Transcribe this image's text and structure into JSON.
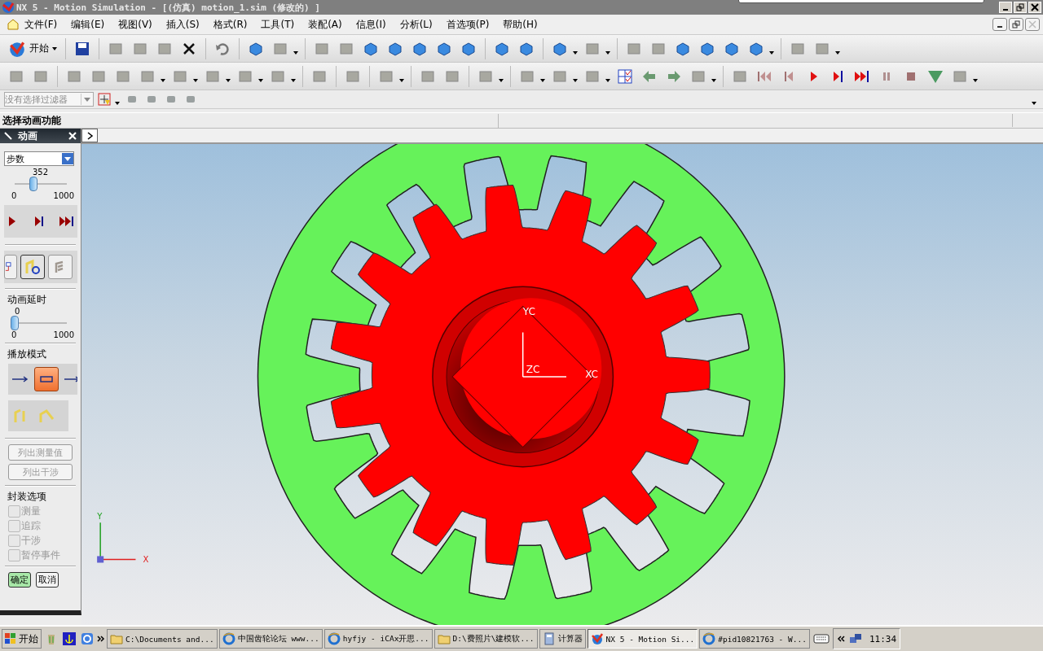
{
  "window": {
    "title": "NX 5 - Motion Simulation - [(仿真) motion_1.sim (修改的) ]"
  },
  "menu": [
    "文件(F)",
    "编辑(E)",
    "视图(V)",
    "插入(S)",
    "格式(R)",
    "工具(T)",
    "装配(A)",
    "信息(I)",
    "分析(L)",
    "首选项(P)",
    "帮助(H)"
  ],
  "toolbar": {
    "start_label": "开始"
  },
  "filter": {
    "value": "没有选择过滤器"
  },
  "status": "选择动画功能",
  "panel": {
    "title": "动画",
    "mode": "步数",
    "step_slider": {
      "value": "352",
      "level": 0.352,
      "min": "0",
      "max": "1000"
    },
    "delay_label": "动画延时",
    "delay_slider": {
      "value": "0",
      "level": 0,
      "min": "0",
      "max": "1000"
    },
    "play_mode_label": "播放模式",
    "play_modes": [
      {
        "selected": false
      },
      {
        "selected": true
      },
      {
        "selected": false
      }
    ],
    "buttons": [
      {
        "label": "列出测量值",
        "disabled": true
      },
      {
        "label": "列出干涉",
        "disabled": true
      }
    ],
    "package_label": "封装选项",
    "options": [
      {
        "label": "测量",
        "checked": false,
        "disabled": true
      },
      {
        "label": "追踪",
        "checked": false,
        "disabled": true
      },
      {
        "label": "干涉",
        "checked": false,
        "disabled": true
      },
      {
        "label": "暂停事件",
        "checked": false,
        "disabled": true
      }
    ],
    "ok": "确定",
    "cancel": "取消"
  },
  "viewport": {
    "yc": "YC",
    "xc": "XC",
    "zc": "ZC",
    "triad_y": "Y",
    "triad_x": "X"
  },
  "taskbar": {
    "start": "开始",
    "tasks": [
      {
        "label": "C:\\Documents and...",
        "kind": "folder",
        "selected": false
      },
      {
        "label": "中国齿轮论坛 www...",
        "kind": "browser",
        "selected": false
      },
      {
        "label": "hyfjy - iCAx开思...",
        "kind": "browser",
        "selected": false
      },
      {
        "label": "D:\\费照片\\建模软...",
        "kind": "folder",
        "selected": false
      },
      {
        "label": "计算器",
        "kind": "calculator",
        "selected": false
      },
      {
        "label": "NX 5 - Motion Si...",
        "kind": "nx",
        "selected": true
      },
      {
        "label": "#pid10821763 - W...",
        "kind": "browser",
        "selected": false
      }
    ],
    "clock": "11:34"
  }
}
